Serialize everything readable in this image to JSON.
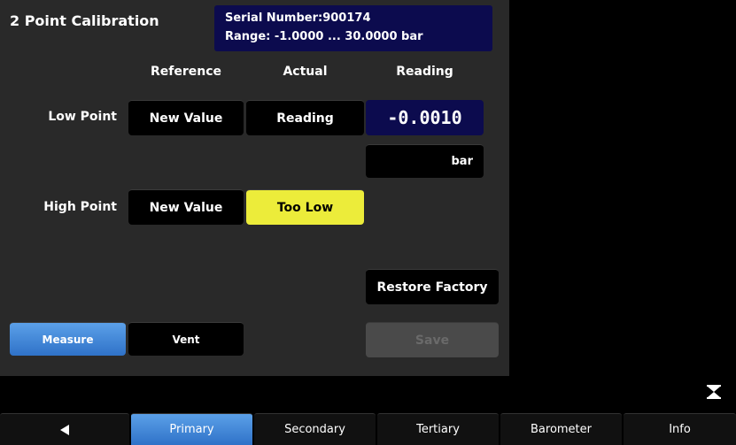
{
  "header": {
    "title": "2 Point Calibration",
    "serial_number": "Serial Number:900174",
    "range": "Range: -1.0000 ... 30.0000 bar"
  },
  "columns": {
    "reference": "Reference",
    "actual": "Actual",
    "reading": "Reading"
  },
  "low_point": {
    "label": "Low Point",
    "reference_button": "New Value",
    "actual_button": "Reading",
    "reading_value": "-0.0010"
  },
  "unit": "bar",
  "high_point": {
    "label": "High Point",
    "reference_button": "New Value",
    "actual_button": "Too Low"
  },
  "actions": {
    "restore_factory": "Restore Factory",
    "save": "Save"
  },
  "mode": {
    "measure": "Measure",
    "vent": "Vent"
  },
  "tabs": [
    {
      "label": "◀",
      "icon": "back-arrow-icon",
      "active": false
    },
    {
      "label": "Primary",
      "active": true
    },
    {
      "label": "Secondary",
      "active": false
    },
    {
      "label": "Tertiary",
      "active": false
    },
    {
      "label": "Barometer",
      "active": false
    },
    {
      "label": "Info",
      "active": false
    }
  ],
  "colors": {
    "panel_bg": "#292929",
    "header_box": "#0c0b4e",
    "warning_yellow": "#ecec3a",
    "active_blue": "#3a82d6"
  }
}
